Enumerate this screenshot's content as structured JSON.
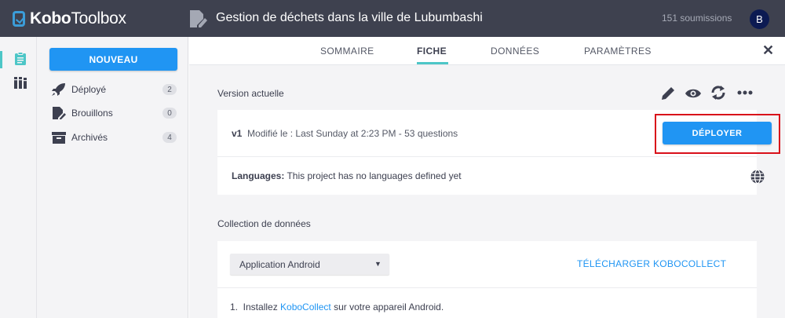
{
  "header": {
    "logo_kobo": "Kobo",
    "logo_toolbox": "Toolbox",
    "form_title": "Gestion de déchets dans la ville de Lubumbashi",
    "submissions": "151 soumissions",
    "avatar_initial": "B",
    "avatar_color": "#0c1a52"
  },
  "rail": {
    "icons": [
      "forms-icon",
      "library-icon"
    ]
  },
  "sidebar": {
    "new_button": "NOUVEAU",
    "items": [
      {
        "label": "Déployé",
        "count": "2",
        "icon": "rocket-icon"
      },
      {
        "label": "Brouillons",
        "count": "0",
        "icon": "drafts-icon"
      },
      {
        "label": "Archivés",
        "count": "4",
        "icon": "archive-icon"
      }
    ]
  },
  "tabs": [
    {
      "label": "SOMMAIRE",
      "active": false
    },
    {
      "label": "FICHE",
      "active": true
    },
    {
      "label": "DONNÉES",
      "active": false
    },
    {
      "label": "PARAMÈTRES",
      "active": false
    }
  ],
  "close_label": "✕",
  "version": {
    "section_title": "Version actuelle",
    "tools": [
      "edit-icon",
      "preview-icon",
      "replace-icon",
      "more-icon"
    ],
    "tag": "v1",
    "modified": "Modifié le : Last Sunday at 2:23 PM - 53 questions",
    "deploy_button": "DÉPLOYER",
    "languages_label": "Languages:",
    "languages_text": "This project has no languages defined yet"
  },
  "collection": {
    "section_title": "Collection de données",
    "select_value": "Application Android",
    "download_link": "TÉLÉCHARGER KOBOCOLLECT",
    "step_prefix": "1.  Installez ",
    "step_link": "KoboCollect",
    "step_suffix": " sur votre appareil Android."
  },
  "colors": {
    "header_bg": "#3e414f",
    "primary": "#2095f3",
    "accent_teal": "#4dc6c7",
    "highlight": "#d9101a"
  }
}
